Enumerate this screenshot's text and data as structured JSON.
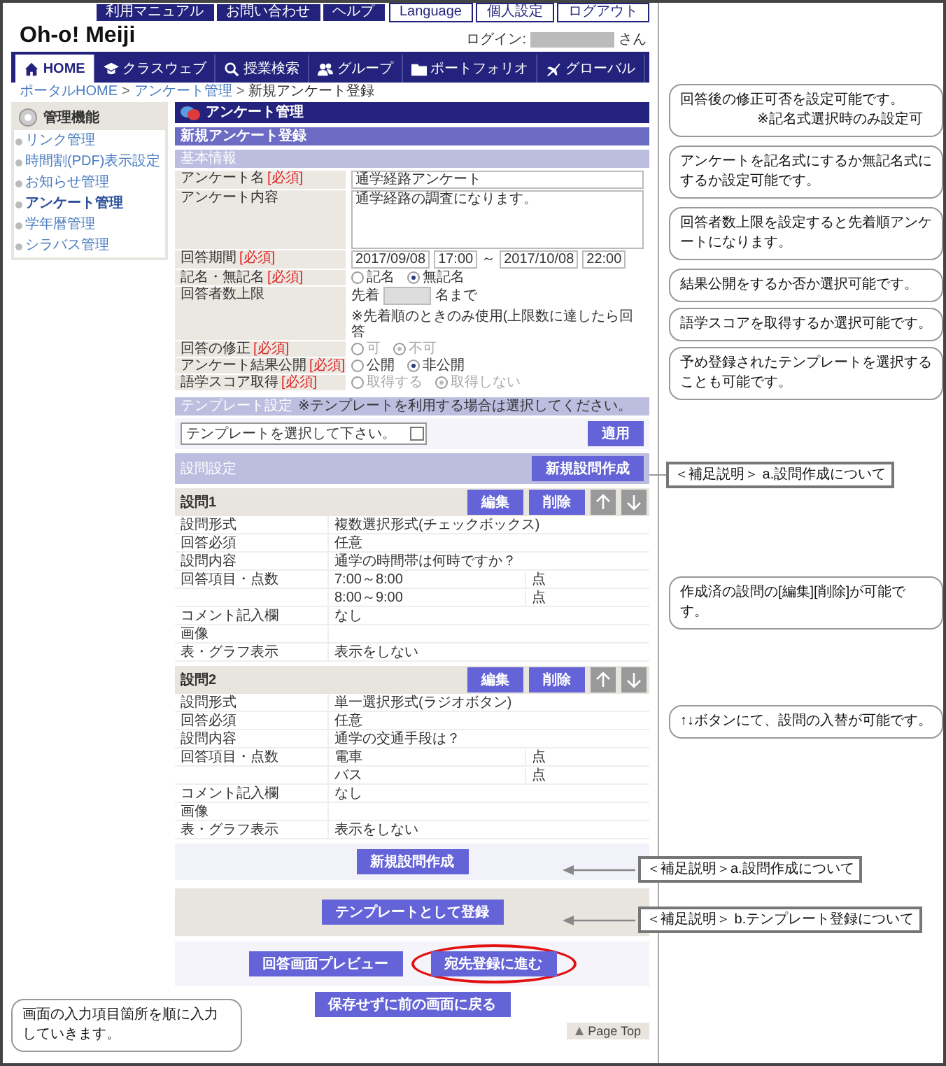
{
  "header": {
    "logo": "Oh-o! Meiji",
    "top_links": [
      {
        "label": "利用マニュアル",
        "kind": "dark"
      },
      {
        "label": "お問い合わせ",
        "kind": "dark"
      },
      {
        "label": "ヘルプ",
        "kind": "dark"
      },
      {
        "label": "Language",
        "kind": "light"
      },
      {
        "label": "個人設定",
        "kind": "light"
      },
      {
        "label": "ログアウト",
        "kind": "light"
      }
    ],
    "login": {
      "label": "ログイン:",
      "suffix": "さん"
    },
    "nav": [
      {
        "label": "HOME",
        "selected": true
      },
      {
        "label": "クラスウェブ",
        "selected": false
      },
      {
        "label": "授業検索",
        "selected": false
      },
      {
        "label": "グループ",
        "selected": false
      },
      {
        "label": "ポートフォリオ",
        "selected": false
      },
      {
        "label": "グローバル",
        "selected": false
      }
    ]
  },
  "breadcrumb": [
    {
      "text": "ポータルHOME",
      "kind": "link"
    },
    {
      "text": ">",
      "kind": "sep"
    },
    {
      "text": "アンケート管理",
      "kind": "link"
    },
    {
      "text": ">",
      "kind": "sep"
    },
    {
      "text": "新規アンケート登録",
      "kind": "current"
    }
  ],
  "sidebar": {
    "title": "管理機能",
    "items": [
      {
        "label": "リンク管理",
        "selected": false
      },
      {
        "label": "時間割(PDF)表示設定",
        "selected": false
      },
      {
        "label": "お知らせ管理",
        "selected": false
      },
      {
        "label": "アンケート管理",
        "selected": true
      },
      {
        "label": "学年暦管理",
        "selected": false
      },
      {
        "label": "シラバス管理",
        "selected": false
      }
    ]
  },
  "main": {
    "title": "アンケート管理",
    "subtitle": "新規アンケート登録",
    "basic_info": {
      "title": "基本情報",
      "fields": [
        {
          "kind": "text",
          "label": "アンケート名",
          "tag": "[必須]",
          "value": "通学経路アンケート"
        },
        {
          "kind": "textarea",
          "label": "アンケート内容",
          "value": "通学経路の調査になります。"
        },
        {
          "kind": "period",
          "label": "回答期間",
          "tag": "[必須]",
          "values": [
            "2017/09/08",
            "17:00",
            "2017/10/08",
            "22:00"
          ],
          "separator": "～"
        },
        {
          "kind": "radio",
          "label": "記名・無記名",
          "tag": "[必須]",
          "disabled": false,
          "options": [
            {
              "label": "記名",
              "selected": false
            },
            {
              "label": "無記名",
              "selected": true
            }
          ]
        },
        {
          "kind": "limit",
          "label": "回答者数上限",
          "prefix": "先着",
          "suffix": "名まで",
          "note": "※先着順のときのみ使用(上限数に達したら回答"
        },
        {
          "kind": "radio",
          "label": "回答の修正",
          "tag": "[必須]",
          "disabled": true,
          "options": [
            {
              "label": "可",
              "selected": false
            },
            {
              "label": "不可",
              "selected": true
            }
          ]
        },
        {
          "kind": "radio",
          "label": "アンケート結果公開",
          "tag": "[必須]",
          "disabled": false,
          "options": [
            {
              "label": "公開",
              "selected": false
            },
            {
              "label": "非公開",
              "selected": true
            }
          ]
        },
        {
          "kind": "radio",
          "label": "語学スコア取得",
          "tag": "[必須]",
          "disabled": true,
          "options": [
            {
              "label": "取得する",
              "selected": false
            },
            {
              "label": "取得しない",
              "selected": true
            }
          ]
        }
      ]
    },
    "template": {
      "title": "テンプレート設定",
      "note": "※テンプレートを利用する場合は選択してください。",
      "select": "テンプレートを選択して下さい。",
      "apply": "適用"
    },
    "question_settings": {
      "title": "設問設定",
      "button": "新規設問作成"
    },
    "questions": [
      {
        "title": "設問1",
        "edit": "編集",
        "delete": "削除",
        "rows": [
          {
            "label": "設問形式",
            "value": "複数選択形式(チェックボックス)"
          },
          {
            "label": "回答必須",
            "value": "任意"
          },
          {
            "label": "設問内容",
            "value": "通学の時間帯は何時ですか？"
          },
          {
            "label": "回答項目・点数",
            "items": [
              {
                "text": "7:00～8:00",
                "unit": "点"
              },
              {
                "text": "8:00～9:00",
                "unit": "点"
              }
            ]
          },
          {
            "label": "コメント記入欄",
            "value": "なし"
          },
          {
            "label": "画像"
          },
          {
            "label": "表・グラフ表示",
            "value": "表示をしない"
          }
        ]
      },
      {
        "title": "設問2",
        "edit": "編集",
        "delete": "削除",
        "rows": [
          {
            "label": "設問形式",
            "value": "単一選択形式(ラジオボタン)"
          },
          {
            "label": "回答必須",
            "value": "任意"
          },
          {
            "label": "設問内容",
            "value": "通学の交通手段は？"
          },
          {
            "label": "回答項目・点数",
            "items": [
              {
                "text": "電車",
                "unit": "点"
              },
              {
                "text": "バス",
                "unit": "点"
              }
            ]
          },
          {
            "label": "コメント記入欄",
            "value": "なし"
          },
          {
            "label": "画像"
          },
          {
            "label": "表・グラフ表示",
            "value": "表示をしない"
          }
        ]
      }
    ],
    "new_question": "新規設問作成",
    "register_template": "テンプレートとして登録",
    "actions": [
      {
        "label": "回答画面プレビュー",
        "highlighted": false
      },
      {
        "label": "宛先登録に進む",
        "highlighted": true
      }
    ],
    "back": "保存せずに前の画面に戻る",
    "page_top": "Page Top"
  },
  "callouts": [
    {
      "kind": "bubble",
      "text": "回答後の修正可否を設定可能です。",
      "subtext": "※記名式選択時のみ設定可"
    },
    {
      "kind": "bubble",
      "text": "アンケートを記名式にするか無記名式にするか設定可能です。"
    },
    {
      "kind": "bubble",
      "text": "回答者数上限を設定すると先着順アンケートになります。"
    },
    {
      "kind": "bubble",
      "text": "結果公開をするか否か選択可能です。"
    },
    {
      "kind": "bubble",
      "text": "語学スコアを取得するか選択可能です。"
    },
    {
      "kind": "bubble",
      "text": "予め登録されたテンプレートを選択することも可能です。"
    },
    {
      "kind": "note",
      "text": "＜補足説明＞ a.設問作成について"
    },
    {
      "kind": "bubble",
      "text": "作成済の設問の[編集][削除]が可能です。"
    },
    {
      "kind": "bubble",
      "text": "↑↓ボタンにて、設問の入替が可能です。"
    },
    {
      "kind": "arrow",
      "text": "＜補足説明＞a.設問作成について"
    },
    {
      "kind": "arrow",
      "text": "＜補足説明＞ b.テンプレート登録について"
    },
    {
      "kind": "bubble",
      "text": "画面の入力項目箇所を順に入力していきます。"
    }
  ]
}
